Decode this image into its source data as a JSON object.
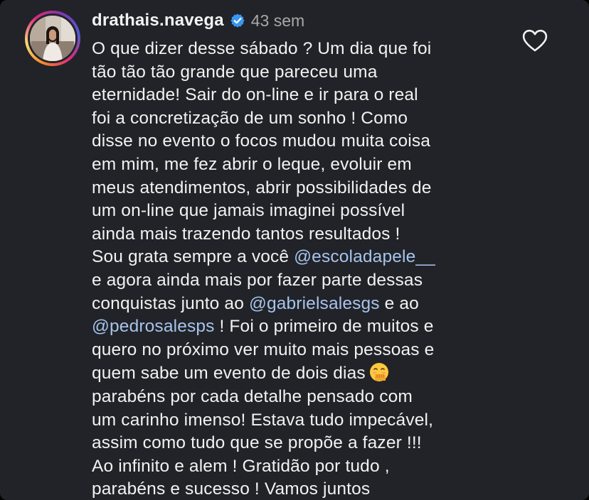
{
  "post": {
    "username": "drathais.navega",
    "time": "43 sem",
    "lines": [
      [
        "O que dizer desse sábado ? Um dia que foi"
      ],
      [
        "tão tão tão grande que pareceu uma"
      ],
      [
        "eternidade! Sair do on-line e ir para o real"
      ],
      [
        "foi a concretização de um sonho ! Como"
      ],
      [
        "disse no evento o focos mudou muita coisa"
      ],
      [
        "em mim, me fez abrir o leque, evoluir em"
      ],
      [
        "meus atendimentos, abrir possibilidades de"
      ],
      [
        "um on-line que jamais imaginei possível"
      ],
      [
        "ainda mais trazendo tantos resultados !"
      ],
      [
        "Sou grata sempre a você ",
        "@escoladapele__"
      ],
      [
        "e agora ainda mais por fazer parte dessas"
      ],
      [
        "conquistas junto ao ",
        "@gabrielsalesgs",
        " e ao"
      ],
      [
        "@pedrosalesps",
        " ! Foi o primeiro de muitos e"
      ],
      [
        "quero no próximo ver muito mais pessoas e"
      ],
      [
        "quem sabe um evento de dois dias"
      ],
      [
        "parabéns por cada detalhe pensado com"
      ],
      [
        "um carinho imenso! Estava tudo impecável,"
      ],
      [
        "assim como tudo que se propõe a fazer !!!"
      ],
      [
        "Ao infinito e alem ! Gratidão por tudo ,"
      ],
      [
        "parabéns e sucesso ! Vamos juntos"
      ]
    ]
  },
  "icons": {
    "verified": "verified-badge-icon",
    "like": "heart-outline-icon",
    "emoji": "face-with-hand-over-mouth-emoji"
  },
  "colors": {
    "background": "#212328",
    "text": "#f2f2f2",
    "secondary": "#a8a8a8",
    "mention": "#a7c4eb",
    "verified": "#3897f0"
  }
}
